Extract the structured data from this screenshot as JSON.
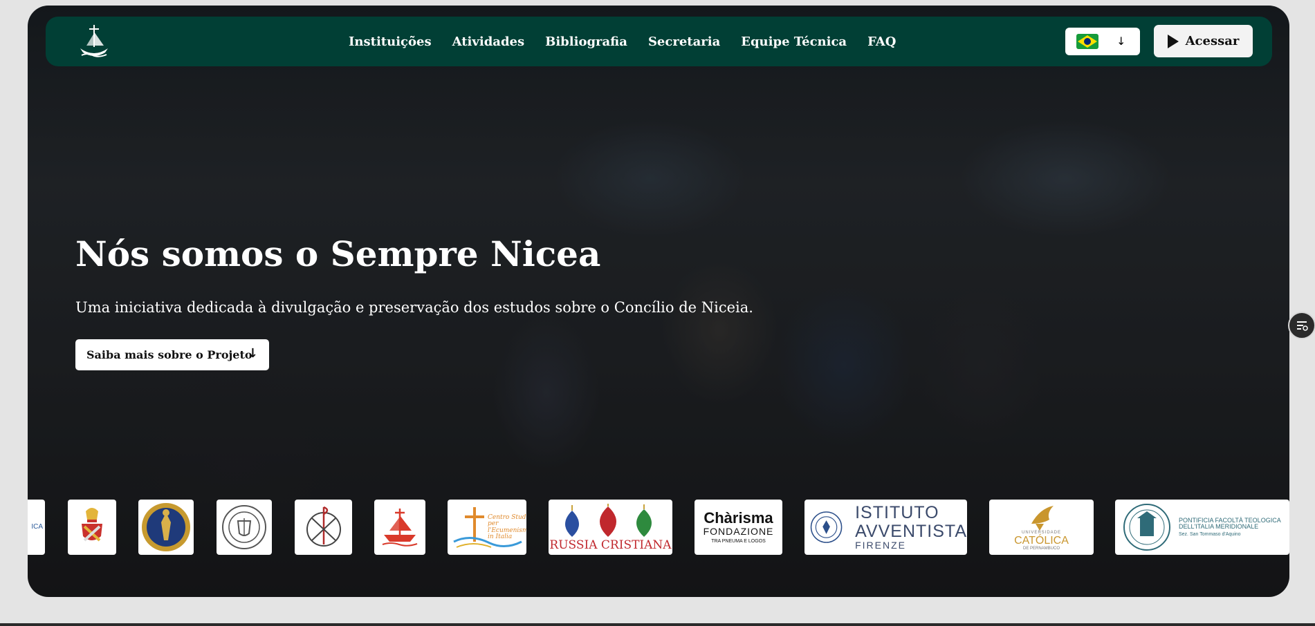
{
  "nav": {
    "links": [
      "Instituições",
      "Atividades",
      "Bibliografia",
      "Secretaria",
      "Equipe Técnica",
      "FAQ"
    ],
    "lang_arrow": "↓",
    "access_label": "Acessar"
  },
  "hero": {
    "title": "Nós somos o Sempre Nicea",
    "subtitle": "Uma iniciativa dedicada à divulgação e preservação dos estudos sobre o Concílio de Niceia.",
    "cta_label": "Saiba mais sobre o Projeto",
    "cta_arrow": "↓"
  },
  "partners": {
    "clipped_text": "ICA",
    "centro_studi": [
      "Centro Studi",
      "per l'Ecumenismo",
      "in Italia"
    ],
    "russia": "RUSSIA CRISTIANA",
    "charisma": [
      "Chàrisma",
      "FONDAZIONE",
      "TRA PNEUMA E LOGOS"
    ],
    "istituto": [
      "ISTITUTO",
      "AVVENTISTA",
      "FIRENZE"
    ],
    "catolica": [
      "UNIVERSIDADE",
      "CATÓLICA",
      "DE PERNAMBUCO"
    ],
    "pontificia": [
      "PONTIFICIA FACOLTÀ TEOLOGICA",
      "DELL'ITALIA MERIDIONALE",
      "Sez. San Tommaso d'Aquino"
    ]
  },
  "colors": {
    "nav_bg": "#013f35",
    "page_bg": "#e4e4e4"
  }
}
